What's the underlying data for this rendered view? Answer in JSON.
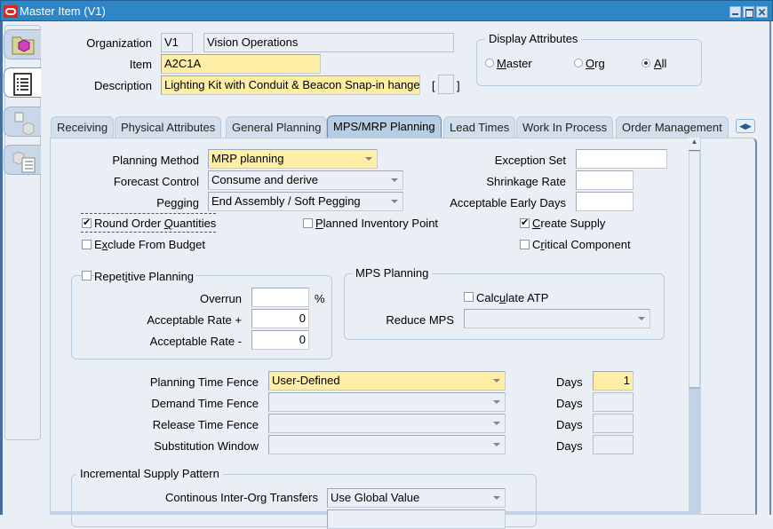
{
  "window": {
    "title": "Master Item (V1)",
    "controls": [
      "minimize",
      "maximize",
      "close"
    ]
  },
  "header": {
    "organization_label": "Organization",
    "organization_code": "V1",
    "organization_name": "Vision Operations",
    "item_label": "Item",
    "item_value": "A2C1A",
    "description_label": "Description",
    "description_value": "Lighting Kit with Conduit & Beacon Snap-in hange",
    "flex_bracket_open": "[",
    "flex_bracket_close": "]"
  },
  "display_attributes": {
    "title": "Display Attributes",
    "options": [
      {
        "label": "Master",
        "underline": "M",
        "selected": false
      },
      {
        "label": "Org",
        "underline": "O",
        "selected": false
      },
      {
        "label": "All",
        "underline": "A",
        "selected": true
      }
    ]
  },
  "sidebar": {
    "items": [
      {
        "icon": "folder-item-icon",
        "active": false
      },
      {
        "icon": "list-document-icon",
        "active": true
      },
      {
        "icon": "org-assign-icon",
        "active": false
      },
      {
        "icon": "categories-list-icon",
        "active": false
      }
    ]
  },
  "tabs": [
    {
      "label": "Receiving",
      "active": false
    },
    {
      "label": "Physical Attributes",
      "active": false
    },
    {
      "label": "General Planning",
      "active": false
    },
    {
      "label": "MPS/MRP Planning",
      "active": true
    },
    {
      "label": "Lead Times",
      "active": false
    },
    {
      "label": "Work In Process",
      "active": false
    },
    {
      "label": "Order Management",
      "active": false
    }
  ],
  "mps_mrp": {
    "planning_method_label": "Planning Method",
    "planning_method_value": "MRP planning",
    "forecast_control_label": "Forecast Control",
    "forecast_control_value": "Consume and derive",
    "pegging_label": "Pegging",
    "pegging_value": "End Assembly / Soft Pegging",
    "exception_set_label": "Exception Set",
    "exception_set_value": "",
    "shrinkage_rate_label": "Shrinkage Rate",
    "shrinkage_rate_value": "",
    "acceptable_early_days_label": "Acceptable Early Days",
    "acceptable_early_days_value": "",
    "checkboxes": {
      "round_order_quantities": {
        "label": "Round Order Quantities",
        "checked": true
      },
      "exclude_from_budget": {
        "label": "Exclude From Budget",
        "checked": false
      },
      "planned_inventory_point": {
        "label": "Planned Inventory Point",
        "checked": false
      },
      "create_supply": {
        "label": "Create Supply",
        "checked": true
      },
      "critical_component": {
        "label": "Critical Component",
        "checked": false
      }
    },
    "repetitive_planning": {
      "label": "Repetitive Planning",
      "checked": false,
      "overrun_label": "Overrun",
      "overrun_value": "",
      "overrun_unit": "%",
      "rate_plus_label": "Acceptable Rate +",
      "rate_plus_value": "0",
      "rate_minus_label": "Acceptable Rate -",
      "rate_minus_value": "0"
    },
    "mps_planning": {
      "title": "MPS Planning",
      "calculate_atp_label": "Calculate ATP",
      "calculate_atp_checked": false,
      "reduce_mps_label": "Reduce MPS",
      "reduce_mps_value": ""
    },
    "time_fences": [
      {
        "label": "Planning Time Fence",
        "value": "User-Defined",
        "days_label": "Days",
        "days": "1"
      },
      {
        "label": "Demand Time Fence",
        "value": "",
        "days_label": "Days",
        "days": ""
      },
      {
        "label": "Release Time Fence",
        "value": "",
        "days_label": "Days",
        "days": ""
      },
      {
        "label": "Substitution Window",
        "value": "",
        "days_label": "Days",
        "days": ""
      }
    ],
    "incremental_supply": {
      "title": "Incremental Supply Pattern",
      "continuous_transfers_label": "Continous Inter-Org Transfers",
      "continuous_transfers_value": "Use Global Value"
    }
  },
  "colors": {
    "titlebar": "#2e86c6",
    "required_field": "#ffeea6",
    "background": "#eaeef5",
    "active_tab": "#b7cde4"
  }
}
